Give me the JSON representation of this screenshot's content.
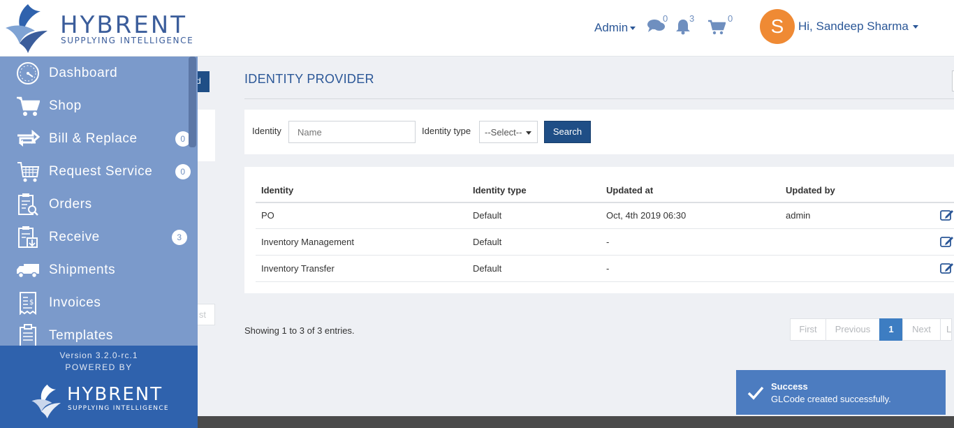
{
  "brand": {
    "name": "HYBRENT",
    "tagline": "SUPPLYING INTELLIGENCE"
  },
  "header": {
    "admin_label": "Admin",
    "messages_count": "0",
    "notifications_count": "3",
    "cart_count": "0",
    "avatar_initial": "S",
    "user_greeting": "Hi, Sandeep Sharma"
  },
  "sidebar": {
    "items": [
      {
        "label": "Dashboard",
        "icon": "dashboard-icon"
      },
      {
        "label": "Shop",
        "icon": "cart-icon"
      },
      {
        "label": "Bill & Replace",
        "icon": "bill-replace-icon",
        "badge": "0"
      },
      {
        "label": "Request Service",
        "icon": "request-service-icon",
        "badge": "0"
      },
      {
        "label": "Orders",
        "icon": "orders-icon"
      },
      {
        "label": "Receive",
        "icon": "receive-icon",
        "badge": "3"
      },
      {
        "label": "Shipments",
        "icon": "truck-icon"
      },
      {
        "label": "Invoices",
        "icon": "invoice-icon"
      },
      {
        "label": "Templates",
        "icon": "templates-icon"
      }
    ],
    "version": "Version 3.2.0-rc.1",
    "powered_by": "POWERED BY",
    "footer_brand": "HYBRENT",
    "footer_tagline": "SUPPLYING INTELLIGENCE"
  },
  "hidden_panel": {
    "button_fragment": "d",
    "pager_fragment": "st"
  },
  "page": {
    "title": "IDENTITY PROVIDER"
  },
  "filters": {
    "identity_label": "Identity",
    "identity_placeholder": "Name",
    "type_label": "Identity type",
    "type_selected": "--Select--",
    "search_label": "Search"
  },
  "table": {
    "columns": [
      "Identity",
      "Identity type",
      "Updated at",
      "Updated by"
    ],
    "rows": [
      {
        "identity": "PO",
        "type": "Default",
        "updated_at": "Oct, 4th 2019 06:30",
        "updated_by": "admin"
      },
      {
        "identity": "Inventory Management",
        "type": "Default",
        "updated_at": "-",
        "updated_by": ""
      },
      {
        "identity": "Inventory Transfer",
        "type": "Default",
        "updated_at": "-",
        "updated_by": ""
      }
    ]
  },
  "summary": "Showing 1 to 3 of 3 entries.",
  "pagination": {
    "first": "First",
    "previous": "Previous",
    "current": "1",
    "next": "Next",
    "last": "L"
  },
  "toast": {
    "title": "Success",
    "message": "GLCode created successfully."
  },
  "colors": {
    "sidebar": "#7b9acb",
    "sidebar_footer": "#2f62ad",
    "primary": "#1f4e86",
    "link": "#2b5797",
    "avatar": "#ef8a34",
    "toast": "#4c7cc0"
  }
}
